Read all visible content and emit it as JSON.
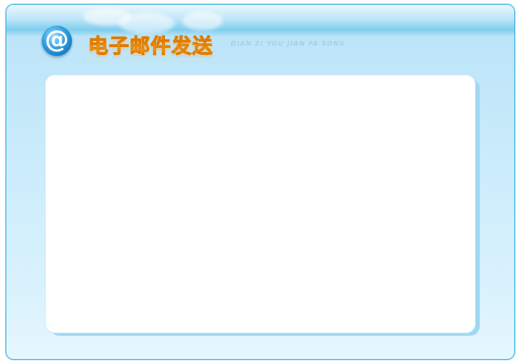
{
  "header": {
    "logo_glyph": "@",
    "title": "电子邮件发送",
    "pinyin": "DIAN ZI YOU JIAN FA SONG"
  },
  "colors": {
    "title_fill": "#ffb422",
    "title_stroke": "#e07a00",
    "frame_border": "#4bb6e0",
    "panel_background": "#ffffff"
  }
}
